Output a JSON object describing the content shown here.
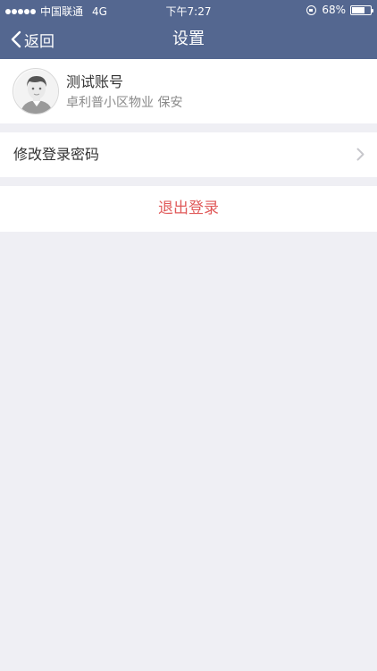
{
  "status_bar": {
    "carrier": "中国联通",
    "network": "4G",
    "time": "下午7:27",
    "battery_text": "68%",
    "battery_level": 0.68,
    "icons": [
      "signal-dots-icon",
      "rotation-lock-icon",
      "battery-icon"
    ]
  },
  "nav": {
    "back_label": "返回",
    "title": "设置",
    "background_color": "#546790"
  },
  "profile": {
    "name": "测试账号",
    "subtitle": "卓利普小区物业 保安",
    "avatar_icon": "user-avatar-icon"
  },
  "settings": {
    "change_password_label": "修改登录密码",
    "chevron_icon": "chevron-right-icon"
  },
  "logout": {
    "label": "退出登录",
    "color": "#e05a5a"
  }
}
